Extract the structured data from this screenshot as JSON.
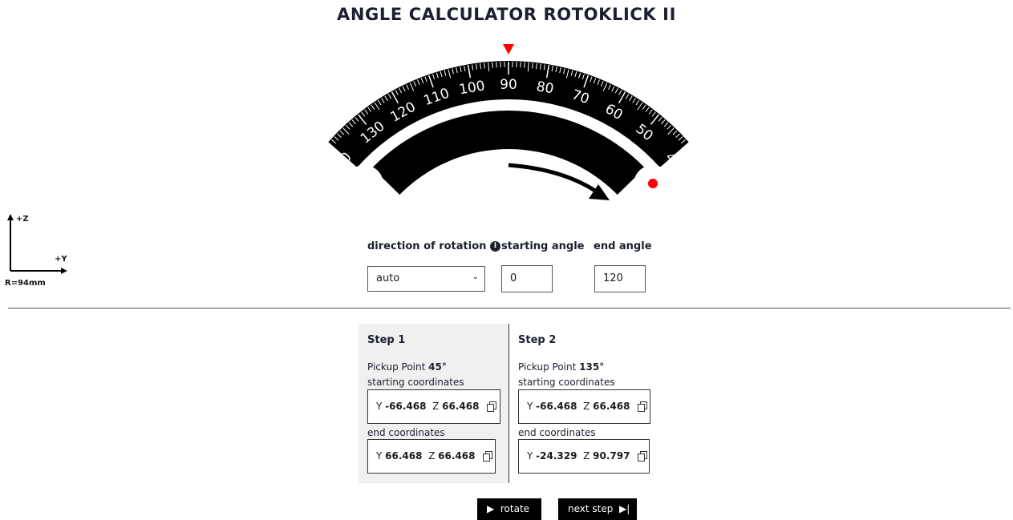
{
  "title": "ANGLE CALCULATOR ROTOKLICK II",
  "dial": {
    "scale_labels": [
      "0",
      "130",
      "120",
      "110",
      "100",
      "90",
      "80",
      "70",
      "60",
      "50",
      "4"
    ],
    "pointer_color": "#ff0000",
    "marker_color": "#ff0000",
    "rotation_arrow": "clockwise-arrow"
  },
  "axes": {
    "z_label": "+Z",
    "y_label": "+Y",
    "radius_label": "R=94mm"
  },
  "controls": {
    "direction_label": "direction of rotation",
    "direction_value": "auto",
    "info_icon": "info-icon",
    "start_label": "starting angle",
    "start_value": "0",
    "end_label": "end angle",
    "end_value": "120"
  },
  "steps": [
    {
      "title": "Step 1",
      "pickup_prefix": "Pickup Point ",
      "pickup_value": "45°",
      "start_label": "starting coordinates",
      "start_y": "-66.468",
      "start_z": "66.468",
      "end_label": "end coordinates",
      "end_y": "66.468",
      "end_z": "66.468"
    },
    {
      "title": "Step 2",
      "pickup_prefix": "Pickup Point ",
      "pickup_value": "135°",
      "start_label": "starting coordinates",
      "start_y": "-66.468",
      "start_z": "66.468",
      "end_label": "end coordinates",
      "end_y": "-24.329",
      "end_z": "90.797"
    }
  ],
  "coord_y_prefix": "Y ",
  "coord_z_prefix": "Z ",
  "buttons": {
    "rotate": "rotate",
    "next_step": "next step"
  }
}
